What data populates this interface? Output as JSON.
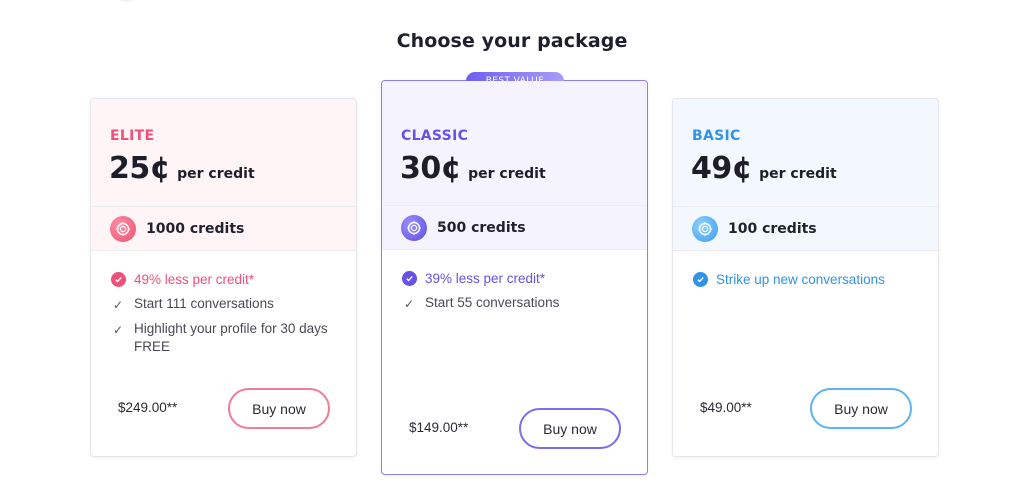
{
  "page": {
    "title": "Choose your package"
  },
  "colors": {
    "elite_accent": "#ef4f7a",
    "classic_accent": "#6553e8",
    "basic_accent": "#2f93e8"
  },
  "packages": [
    {
      "tier": "ELITE",
      "price": "25¢",
      "price_unit": "per credit",
      "credits": "1000 credits",
      "features": [
        {
          "text": "49% less per credit*",
          "highlight": true
        },
        {
          "text": "Start 111 conversations",
          "highlight": false
        },
        {
          "text": "Highlight your profile for 30 days FREE",
          "highlight": false
        }
      ],
      "total": "$249.00**",
      "button": "Buy now"
    },
    {
      "tier": "CLASSIC",
      "badge": "BEST VALUE",
      "price": "30¢",
      "price_unit": "per credit",
      "credits": "500 credits",
      "features": [
        {
          "text": "39% less per credit*",
          "highlight": true
        },
        {
          "text": "Start 55 conversations",
          "highlight": false
        }
      ],
      "total": "$149.00**",
      "button": "Buy now"
    },
    {
      "tier": "BASIC",
      "price": "49¢",
      "price_unit": "per credit",
      "credits": "100 credits",
      "features": [
        {
          "text": "Strike up new conversations",
          "highlight": true
        }
      ],
      "total": "$49.00**",
      "button": "Buy now"
    }
  ]
}
